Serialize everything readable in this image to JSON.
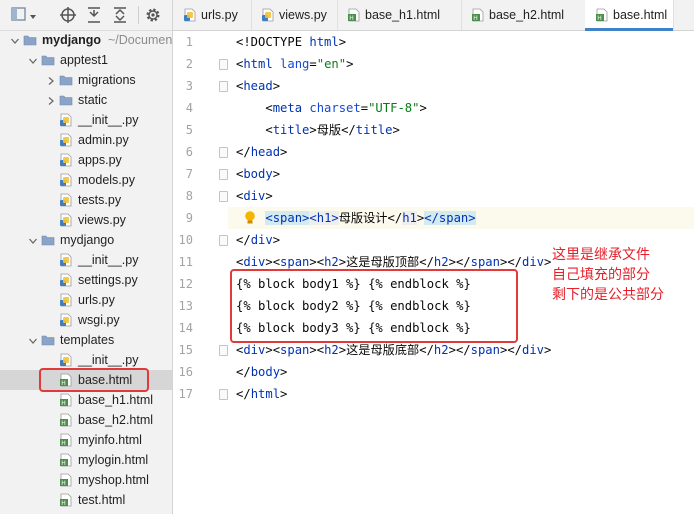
{
  "project": {
    "root_name": "mydjango",
    "root_path": "~/Documents",
    "tree": [
      {
        "label": "mydjango",
        "extra": "~/Documents",
        "type": "folder",
        "depth": 0,
        "expanded": true
      },
      {
        "label": "apptest1",
        "type": "folder",
        "depth": 1,
        "expanded": true
      },
      {
        "label": "migrations",
        "type": "folder",
        "depth": 2,
        "expanded": false
      },
      {
        "label": "static",
        "type": "folder",
        "depth": 2,
        "expanded": false
      },
      {
        "label": "__init__.py",
        "type": "py",
        "depth": 2
      },
      {
        "label": "admin.py",
        "type": "py",
        "depth": 2
      },
      {
        "label": "apps.py",
        "type": "py",
        "depth": 2
      },
      {
        "label": "models.py",
        "type": "py",
        "depth": 2
      },
      {
        "label": "tests.py",
        "type": "py",
        "depth": 2
      },
      {
        "label": "views.py",
        "type": "py",
        "depth": 2
      },
      {
        "label": "mydjango",
        "type": "folder",
        "depth": 1,
        "expanded": true
      },
      {
        "label": "__init__.py",
        "type": "py",
        "depth": 2
      },
      {
        "label": "settings.py",
        "type": "py",
        "depth": 2
      },
      {
        "label": "urls.py",
        "type": "py",
        "depth": 2
      },
      {
        "label": "wsgi.py",
        "type": "py",
        "depth": 2
      },
      {
        "label": "templates",
        "type": "folder",
        "depth": 1,
        "expanded": true
      },
      {
        "label": "__init__.py",
        "type": "py",
        "depth": 2
      },
      {
        "label": "base.html",
        "type": "html",
        "depth": 2,
        "selected": true
      },
      {
        "label": "base_h1.html",
        "type": "html",
        "depth": 2
      },
      {
        "label": "base_h2.html",
        "type": "html",
        "depth": 2
      },
      {
        "label": "myinfo.html",
        "type": "html",
        "depth": 2
      },
      {
        "label": "mylogin.html",
        "type": "html",
        "depth": 2
      },
      {
        "label": "myshop.html",
        "type": "html",
        "depth": 2
      },
      {
        "label": "test.html",
        "type": "html",
        "depth": 2
      }
    ]
  },
  "tabs": [
    {
      "label": "urls.py",
      "type": "py"
    },
    {
      "label": "views.py",
      "type": "py"
    },
    {
      "label": "base_h1.html",
      "type": "html"
    },
    {
      "label": "base_h2.html",
      "type": "html"
    },
    {
      "label": "base.html",
      "type": "html",
      "active": true
    }
  ],
  "editor": {
    "line_numbers": [
      "1",
      "2",
      "3",
      "4",
      "5",
      "6",
      "7",
      "8",
      "9",
      "10",
      "11",
      "12",
      "13",
      "14",
      "15",
      "16",
      "17"
    ],
    "lines": [
      [
        [
          "tx",
          "<!DOCTYPE "
        ],
        [
          "tag",
          "html"
        ],
        [
          "tx",
          ">"
        ]
      ],
      [
        [
          "tx",
          "<"
        ],
        [
          "tag",
          "html "
        ],
        [
          "attr",
          "lang"
        ],
        [
          "tx",
          "="
        ],
        [
          "str",
          "\"en\""
        ],
        [
          "tx",
          ">"
        ]
      ],
      [
        [
          "tx",
          "<"
        ],
        [
          "tag",
          "head"
        ],
        [
          "tx",
          ">"
        ]
      ],
      [
        [
          "tx",
          "    <"
        ],
        [
          "tag",
          "meta "
        ],
        [
          "attr",
          "charset"
        ],
        [
          "tx",
          "="
        ],
        [
          "str",
          "\"UTF-8\""
        ],
        [
          "tx",
          ">"
        ]
      ],
      [
        [
          "tx",
          "    <"
        ],
        [
          "tag",
          "title"
        ],
        [
          "tx",
          ">母版</"
        ],
        [
          "tag",
          "title"
        ],
        [
          "tx",
          ">"
        ]
      ],
      [
        [
          "tx",
          "</"
        ],
        [
          "tag",
          "head"
        ],
        [
          "tx",
          ">"
        ]
      ],
      [
        [
          "tx",
          "<"
        ],
        [
          "tag",
          "body"
        ],
        [
          "tx",
          ">"
        ]
      ],
      [
        [
          "tx",
          "<"
        ],
        [
          "tag",
          "div"
        ],
        [
          "tx",
          ">"
        ]
      ],
      [
        [
          "tx",
          "    "
        ],
        [
          "span",
          "<span>"
        ],
        [
          "h1",
          "<h1>"
        ],
        [
          "tx",
          "母版设计</"
        ],
        [
          "h1",
          "h1"
        ],
        [
          "tx",
          ">"
        ],
        [
          "span",
          "</span>"
        ]
      ],
      [
        [
          "tx",
          "</"
        ],
        [
          "tag",
          "div"
        ],
        [
          "tx",
          ">"
        ]
      ],
      [
        [
          "tx",
          "<"
        ],
        [
          "tag",
          "div"
        ],
        [
          "tx",
          "><"
        ],
        [
          "tag",
          "span"
        ],
        [
          "tx",
          "><"
        ],
        [
          "tag",
          "h2"
        ],
        [
          "tx",
          ">这是母版顶部</"
        ],
        [
          "tag",
          "h2"
        ],
        [
          "tx",
          "></"
        ],
        [
          "tag",
          "span"
        ],
        [
          "tx",
          "></"
        ],
        [
          "tag",
          "div"
        ],
        [
          "tx",
          ">"
        ]
      ],
      [
        [
          "tx",
          "{% block body1 %} {% endblock %}"
        ]
      ],
      [
        [
          "tx",
          "{% block body2 %} {% endblock %}"
        ]
      ],
      [
        [
          "tx",
          "{% block body3 %} {% endblock %}"
        ]
      ],
      [
        [
          "tx",
          "<"
        ],
        [
          "tag",
          "div"
        ],
        [
          "tx",
          "><"
        ],
        [
          "tag",
          "span"
        ],
        [
          "tx",
          "><"
        ],
        [
          "tag",
          "h2"
        ],
        [
          "tx",
          ">这是母版底部</"
        ],
        [
          "tag",
          "h2"
        ],
        [
          "tx",
          "></"
        ],
        [
          "tag",
          "span"
        ],
        [
          "tx",
          "></"
        ],
        [
          "tag",
          "div"
        ],
        [
          "tx",
          ">"
        ]
      ],
      [
        [
          "tx",
          "</"
        ],
        [
          "tag",
          "body"
        ],
        [
          "tx",
          ">"
        ]
      ],
      [
        [
          "tx",
          "</"
        ],
        [
          "tag",
          "html"
        ],
        [
          "tx",
          ">"
        ]
      ]
    ],
    "highlighted_line": 9
  },
  "annotation": [
    "这里是继承文件",
    "自己填充的部分",
    "剩下的是公共部分"
  ],
  "colors": {
    "accent": "#4083c9",
    "annotation_red": "#e23a3a",
    "folder": "#8aa4c8",
    "py_icon": "#3f7fbf",
    "html_icon": "#4c8f4c"
  },
  "icons": {
    "toolbar": [
      "project-view-icon",
      "target-icon",
      "collapse-all-icon",
      "expand-all-icon",
      "gear-icon"
    ],
    "bulb": "lightbulb-icon"
  }
}
